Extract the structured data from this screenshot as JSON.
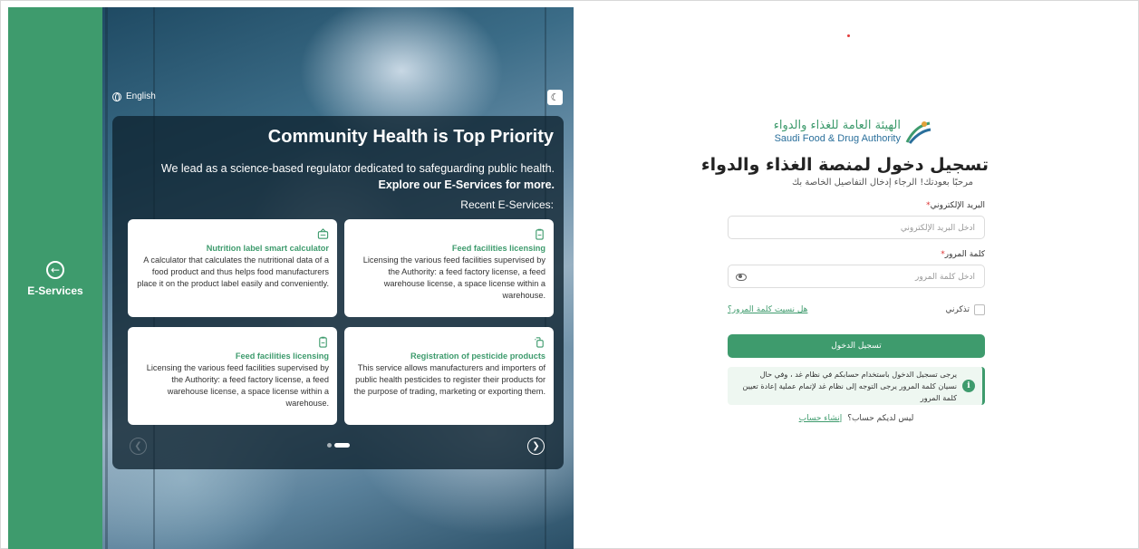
{
  "rail": {
    "label": "E-Services",
    "icon": "arrow-left-circle-icon"
  },
  "hero": {
    "language": "English",
    "theme_icon": "moon-icon",
    "title": "Community Health is Top Priority",
    "subtitle_plain": "We lead as a science-based regulator dedicated to safeguarding public health.",
    "subtitle_bold": "Explore our E-Services for more.",
    "recent_label": "Recent E-Services:",
    "cards": [
      {
        "icon": "feed-facility-icon",
        "title": "Feed facilities licensing",
        "description": "Licensing the various feed facilities supervised by the Authority: a feed factory license, a feed warehouse license, a space license within a warehouse."
      },
      {
        "icon": "nutrition-label-icon",
        "title": "Nutrition label smart calculator",
        "description": "A calculator that calculates the nutritional data of a food product and thus helps food manufacturers place it on the product label easily and conveniently."
      },
      {
        "icon": "pesticide-icon",
        "title": "Registration of pesticide products",
        "description": "This service allows manufacturers and importers of public health pesticides to register their products for the purpose of trading, marketing or exporting them."
      },
      {
        "icon": "feed-facility-icon",
        "title": "Feed facilities licensing",
        "description": "Licensing the various feed facilities supervised by the Authority: a feed factory license, a feed warehouse license, a space license within a warehouse."
      }
    ],
    "carousel": {
      "slides": 2,
      "active": 1
    }
  },
  "login": {
    "logo_ar": "الهيئة العامة للغذاء والدواء",
    "logo_en": "Saudi Food & Drug Authority",
    "title": "تسجيل دخول لمنصة الغذاء والدواء",
    "welcome": "مرحبًا بعودتك! الرجاء إدخال التفاصيل الخاصة بك",
    "email_label": "البريد الإلكتروني",
    "email_placeholder": "أدخل البريد الإلكتروني",
    "password_label": "كلمة المرور",
    "password_placeholder": "أدخل كلمة المرور",
    "required_mark": "*",
    "remember_label": "تذكرني",
    "forgot_link": "هل نسيت كلمة المرور؟",
    "submit_label": "تسجيل الدخول",
    "info_text": "يرجى تسجيل الدخول باستخدام حسابكم في نظام غد ، وفي حال نسيان كلمة المرور يرجى التوجه إلى نظام غد لإتمام عملية إعادة تعيين كلمة المرور",
    "no_account": "ليس لديكم حساب؟",
    "create_account": "إنشاء حساب"
  },
  "colors": {
    "brand_green": "#3e9b6d",
    "overlay": "#0e2230",
    "accent_red": "#e23b3b"
  }
}
